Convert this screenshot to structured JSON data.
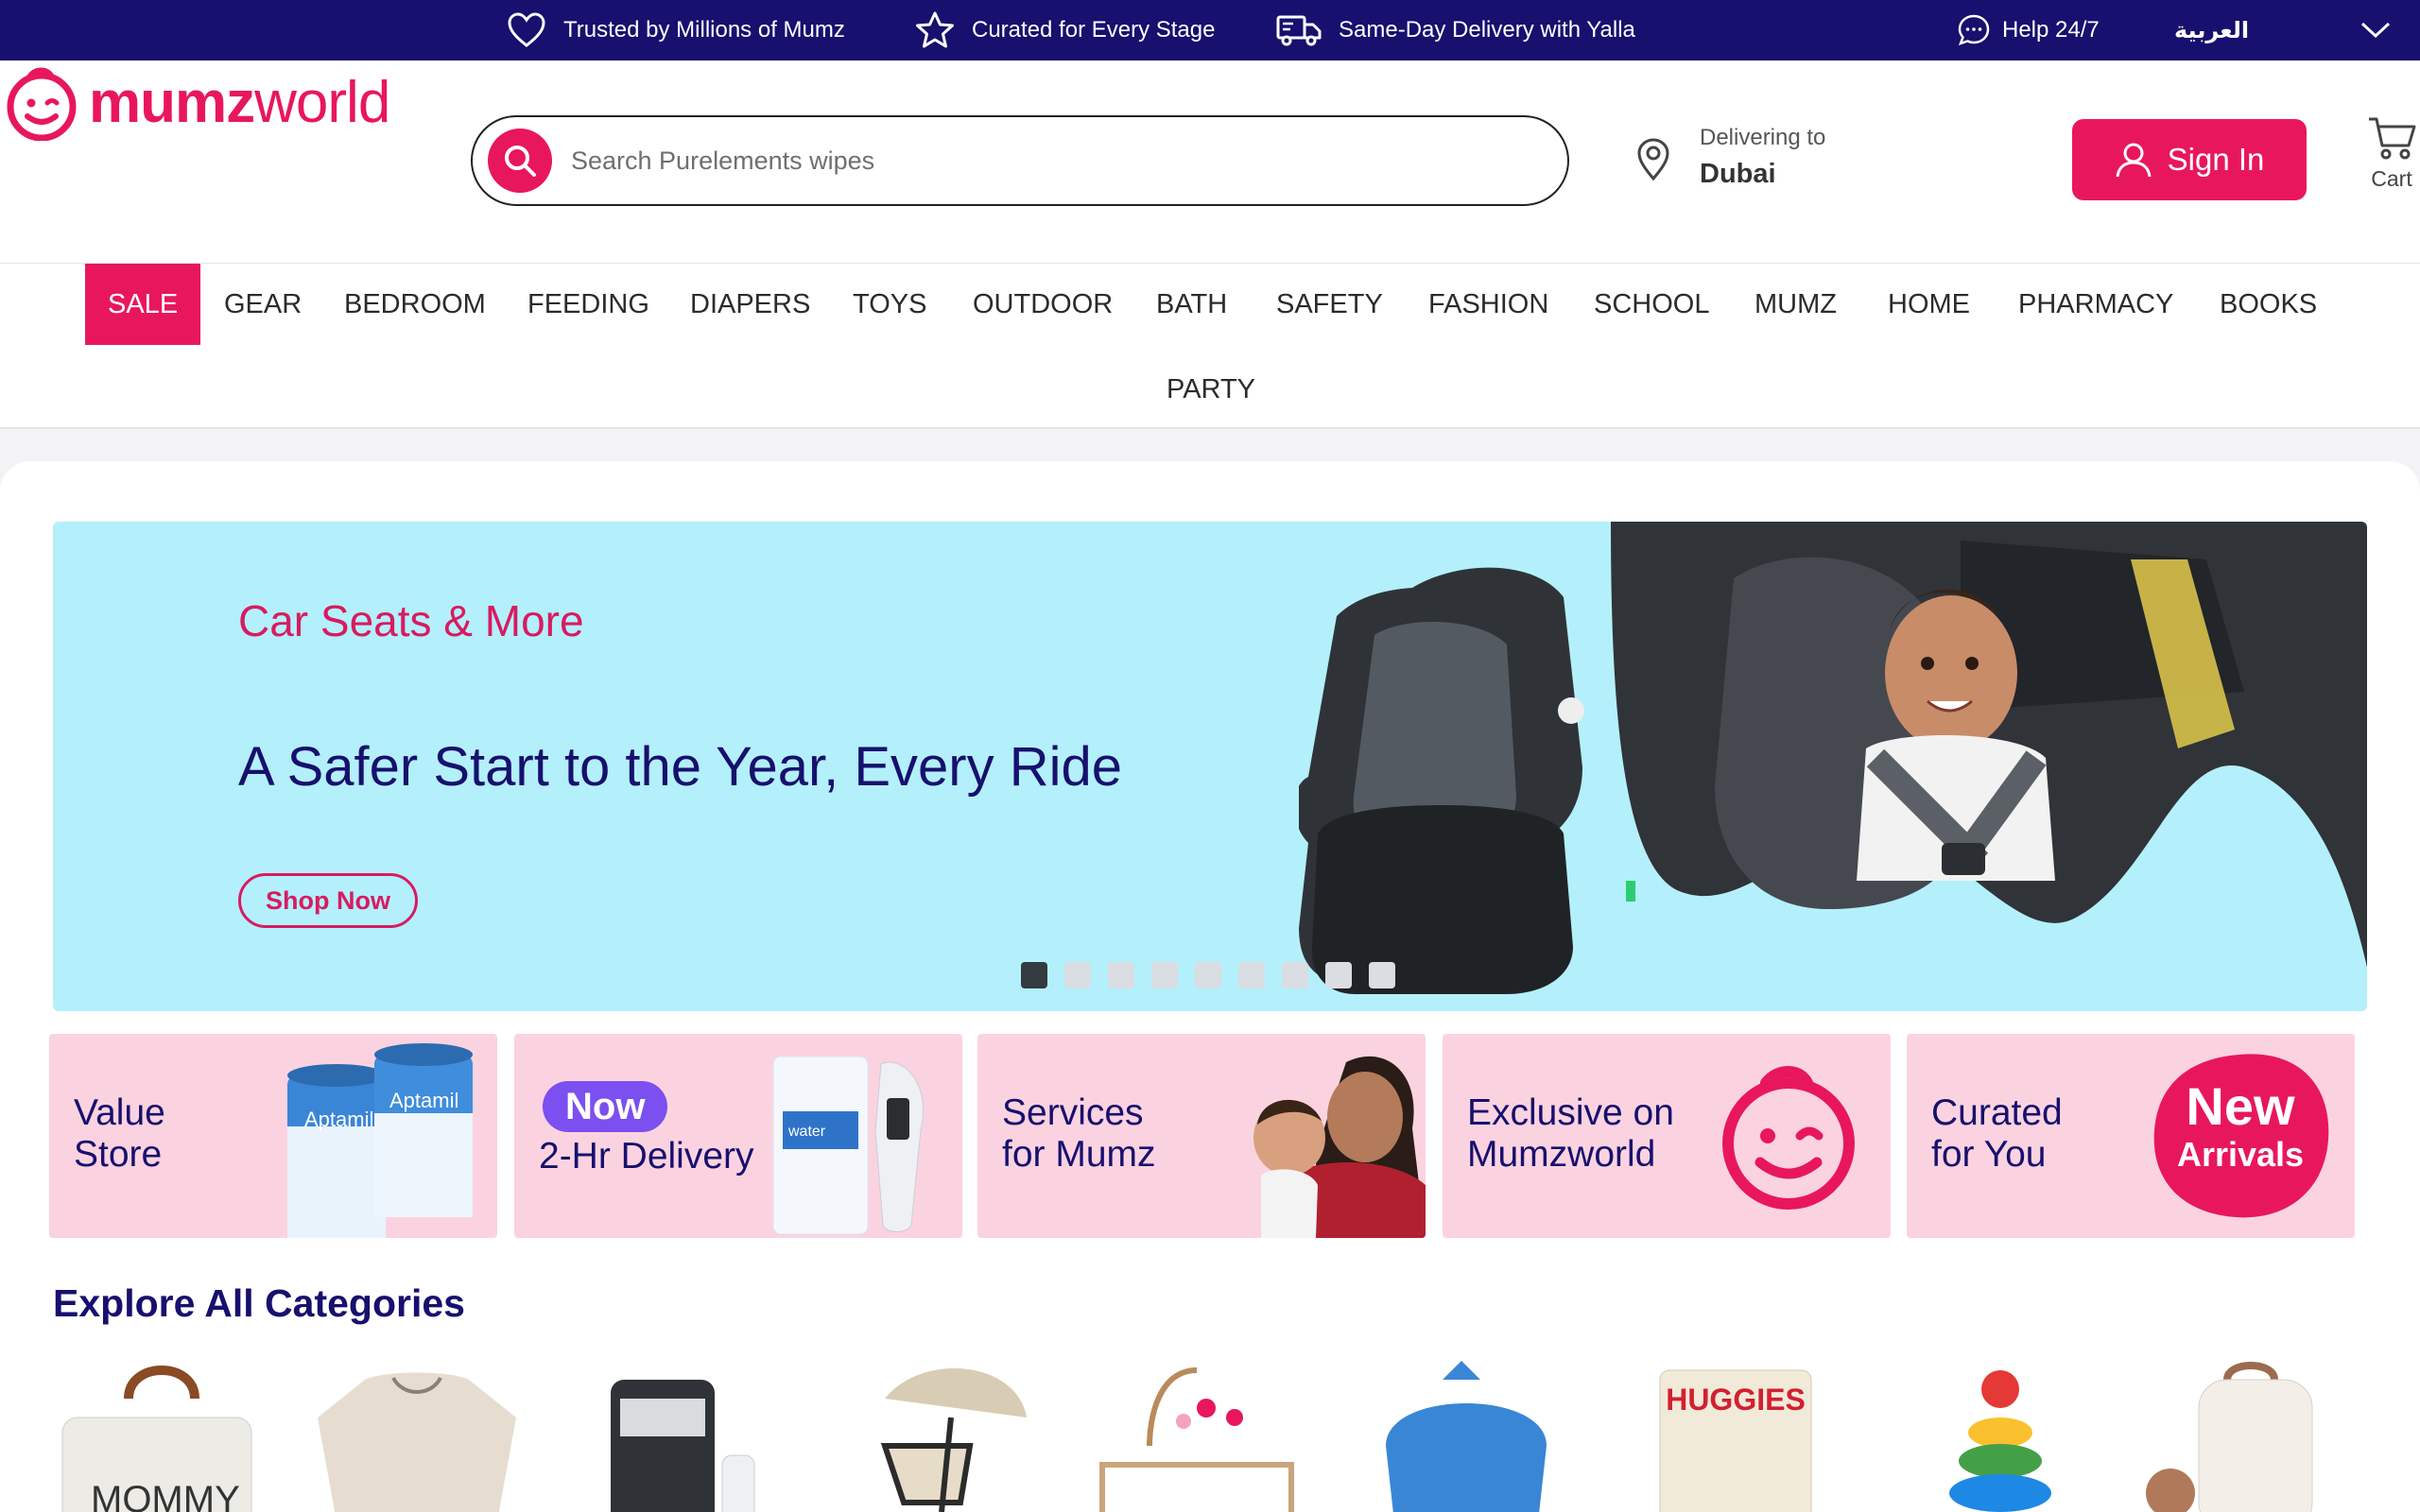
{
  "topbar": {
    "items": [
      {
        "label": "Trusted by Millions of Mumz",
        "icon": "heart-icon"
      },
      {
        "label": "Curated for Every Stage",
        "icon": "star-icon"
      },
      {
        "label": "Same-Day Delivery with Yalla",
        "icon": "truck-icon"
      }
    ],
    "help": {
      "label": "Help 24/7",
      "icon": "chat-icon"
    },
    "language": "العربية"
  },
  "header": {
    "logo": {
      "part1": "mumz",
      "part2": "world"
    },
    "search": {
      "placeholder": "Search Purelements wipes"
    },
    "delivery": {
      "label": "Delivering to",
      "city": "Dubai"
    },
    "sign_in": "Sign In",
    "cart": "Cart"
  },
  "nav": {
    "items": [
      "SALE",
      "GEAR",
      "BEDROOM",
      "FEEDING",
      "DIAPERS",
      "TOYS",
      "OUTDOOR",
      "BATH",
      "SAFETY",
      "FASHION",
      "SCHOOL",
      "MUMZ",
      "HOME",
      "PHARMACY",
      "BOOKS",
      "PARTY"
    ]
  },
  "hero": {
    "eyebrow": "Car Seats & More",
    "title": "A Safer Start to the Year, Every Ride",
    "button": "Shop Now",
    "slide_count": 9,
    "active_slide": 1,
    "background": "#b3f0fb"
  },
  "promos": [
    {
      "label": "Value\nStore"
    },
    {
      "badge": "Now",
      "label": "2-Hr Delivery"
    },
    {
      "label": "Services\nfor Mumz"
    },
    {
      "label": "Exclusive on\nMumzworld"
    },
    {
      "label": "Curated\nfor You",
      "badge_art": "New\nArrivals"
    }
  ],
  "categories": {
    "title": "Explore All Categories"
  },
  "colors": {
    "brand": "#e8175d",
    "navy": "#17106e",
    "promo_bg": "#fbd3e0"
  }
}
